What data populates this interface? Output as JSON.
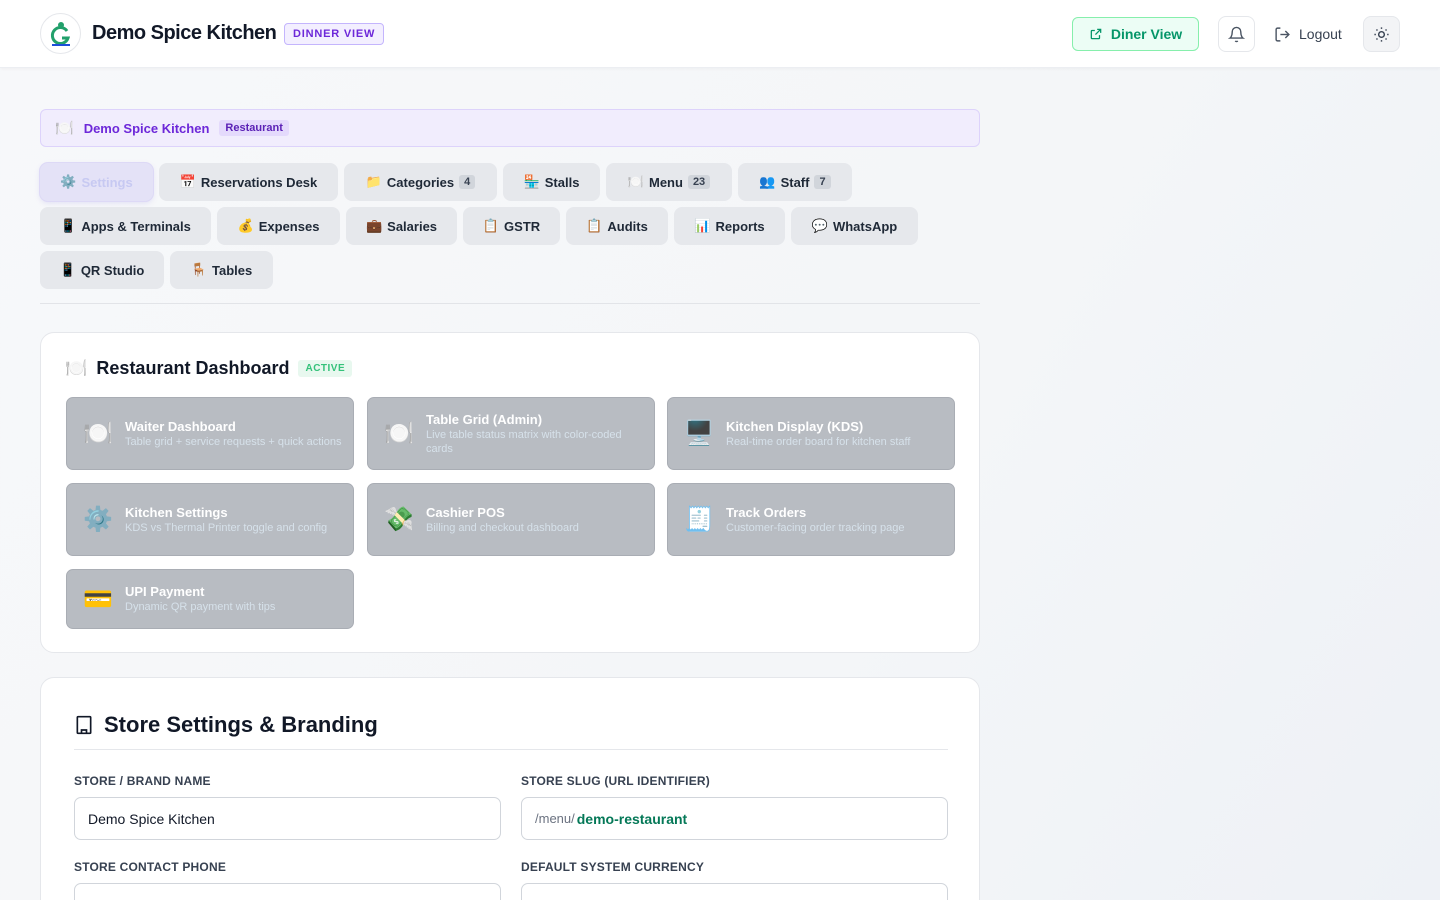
{
  "header": {
    "title": "Demo Spice Kitchen",
    "view_badge": "DINNER VIEW",
    "diner_view_label": "Diner View",
    "logout_label": "Logout"
  },
  "banner": {
    "emoji": "🍽️",
    "name": "Demo Spice Kitchen",
    "type": "Restaurant"
  },
  "tabs": [
    {
      "emoji": "⚙️",
      "label": "Settings",
      "active": true
    },
    {
      "emoji": "📅",
      "label": "Reservations Desk"
    },
    {
      "emoji": "📁",
      "label": "Categories",
      "count": "4"
    },
    {
      "emoji": "🏪",
      "label": "Stalls"
    },
    {
      "emoji": "🍽️",
      "label": "Menu",
      "count": "23"
    },
    {
      "emoji": "👥",
      "label": "Staff",
      "count": "7"
    },
    {
      "emoji": "📱",
      "label": "Apps & Terminals"
    },
    {
      "emoji": "💰",
      "label": "Expenses"
    },
    {
      "emoji": "💼",
      "label": "Salaries"
    },
    {
      "emoji": "📋",
      "label": "GSTR"
    },
    {
      "emoji": "📋",
      "label": "Audits"
    },
    {
      "emoji": "📊",
      "label": "Reports"
    },
    {
      "emoji": "💬",
      "label": "WhatsApp"
    },
    {
      "emoji": "📱",
      "label": "QR Studio"
    },
    {
      "emoji": "🪑",
      "label": "Tables"
    }
  ],
  "dashboard": {
    "emoji": "🍽️",
    "title": "Restaurant Dashboard",
    "status": "ACTIVE",
    "tiles": [
      {
        "icon": "🍽️",
        "title": "Waiter Dashboard",
        "desc": "Table grid + service requests + quick actions"
      },
      {
        "icon": "🍽️",
        "title": "Table Grid (Admin)",
        "desc": "Live table status matrix with color-coded cards"
      },
      {
        "icon": "🖥️",
        "title": "Kitchen Display (KDS)",
        "desc": "Real-time order board for kitchen staff"
      },
      {
        "icon": "⚙️",
        "title": "Kitchen Settings",
        "desc": "KDS vs Thermal Printer toggle and config"
      },
      {
        "icon": "💸",
        "title": "Cashier POS",
        "desc": "Billing and checkout dashboard"
      },
      {
        "icon": "🧾",
        "title": "Track Orders",
        "desc": "Customer-facing order tracking page"
      },
      {
        "icon": "💳",
        "title": "UPI Payment",
        "desc": "Dynamic QR payment with tips"
      }
    ]
  },
  "store": {
    "title": "Store Settings & Branding",
    "brand_name_label": "STORE / BRAND NAME",
    "brand_name_value": "Demo Spice Kitchen",
    "slug_label": "STORE SLUG (URL IDENTIFIER)",
    "slug_prefix": "/menu/",
    "slug_value": "demo-restaurant",
    "phone_label": "STORE CONTACT PHONE",
    "currency_label": "DEFAULT SYSTEM CURRENCY"
  }
}
